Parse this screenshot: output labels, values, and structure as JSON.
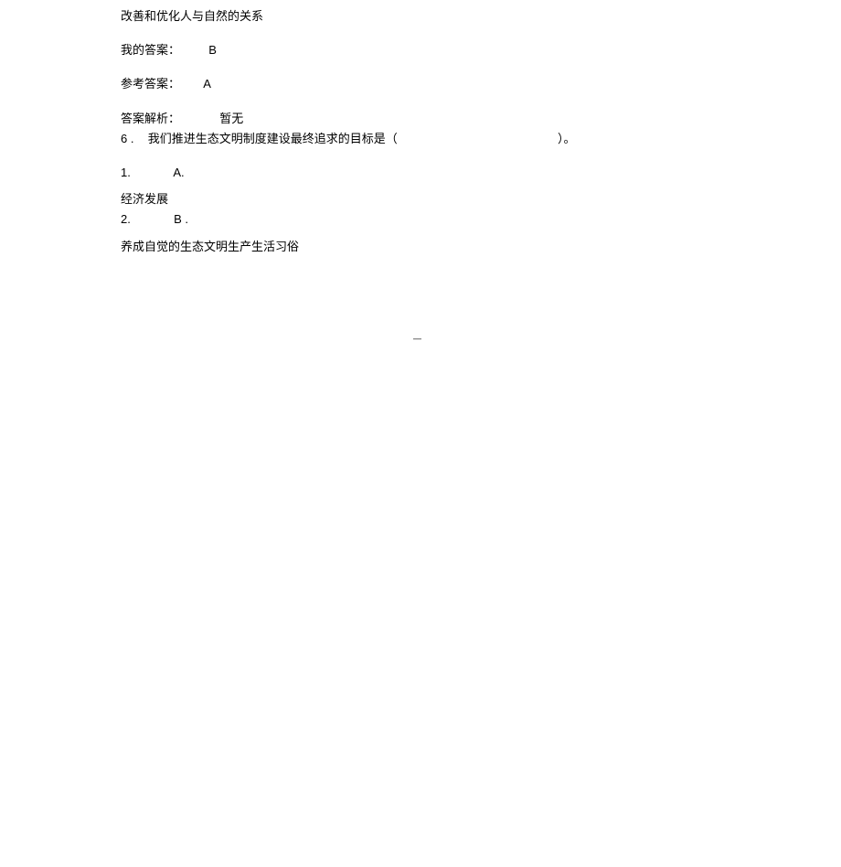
{
  "lines": {
    "l1": "改善和优化人与自然的关系",
    "l2a": "我的答案：",
    "l2b": "B",
    "l3a": "参考答案：",
    "l3b": "A",
    "l4a": "答案解析：",
    "l4b": "暂无",
    "l5a": "6 .",
    "l5b": "我们推进生态文明制度建设最终追求的目标是（",
    "l5c": "）。",
    "l6a": "1.",
    "l6b": "A.",
    "l7": "经济发展",
    "l8a": "2.",
    "l8b": "B .",
    "l9": "养成自觉的生态文明生产生活习俗"
  },
  "footer": "—"
}
